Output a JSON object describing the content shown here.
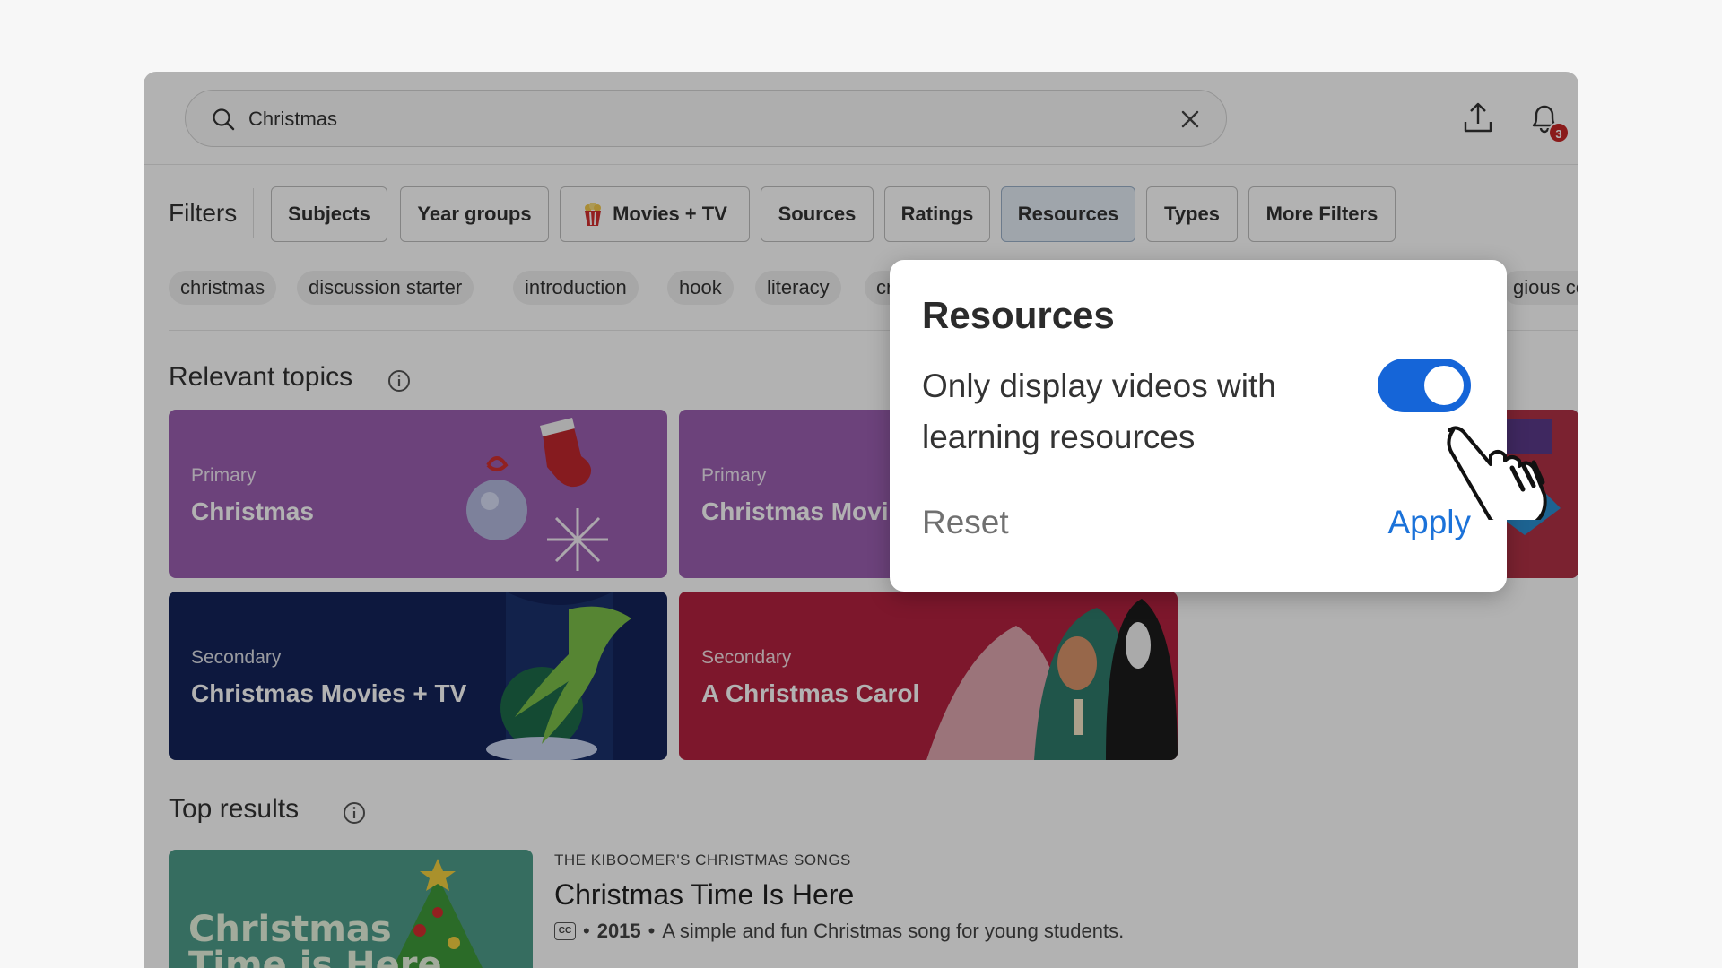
{
  "header": {
    "search_value": "Christmas",
    "notification_count": "3"
  },
  "filters": {
    "label": "Filters",
    "buttons": [
      "Subjects",
      "Year groups",
      "Movies + TV",
      "Sources",
      "Ratings",
      "Resources",
      "Types",
      "More Filters"
    ],
    "active": "Resources"
  },
  "tags": [
    "christmas",
    "discussion starter",
    "introduction",
    "hook",
    "literacy",
    "crea",
    "gious ce"
  ],
  "relevant_topics": {
    "title": "Relevant topics",
    "cards": [
      {
        "level": "Primary",
        "name": "Christmas",
        "color": "#9b5fb0"
      },
      {
        "level": "Primary",
        "name": "Christmas Movi",
        "color": "#9b5fb0"
      },
      {
        "level": "Secondary",
        "name": "Christmas Movies + TV",
        "color": "#14235a"
      },
      {
        "level": "Secondary",
        "name": "A Christmas Carol",
        "color": "#b3223f"
      }
    ]
  },
  "top_results": {
    "title": "Top results",
    "items": [
      {
        "source": "THE KIBOOMER'S CHRISTMAS SONGS",
        "title": "Christmas Time Is Here",
        "cc": "CC",
        "year": "2015",
        "description": "A simple and fun Christmas song for young students.",
        "thumb_text_1": "Christmas",
        "thumb_text_2": "Time is Here"
      }
    ]
  },
  "popover": {
    "title": "Resources",
    "description": "Only display videos with learning resources",
    "toggle_on": true,
    "reset_label": "Reset",
    "apply_label": "Apply",
    "accent_color": "#1565d8"
  },
  "icons": [
    "search-icon",
    "close-icon",
    "upload-icon",
    "bell-icon",
    "popcorn-icon",
    "info-icon",
    "closed-captions-icon",
    "hand-cursor-icon"
  ]
}
